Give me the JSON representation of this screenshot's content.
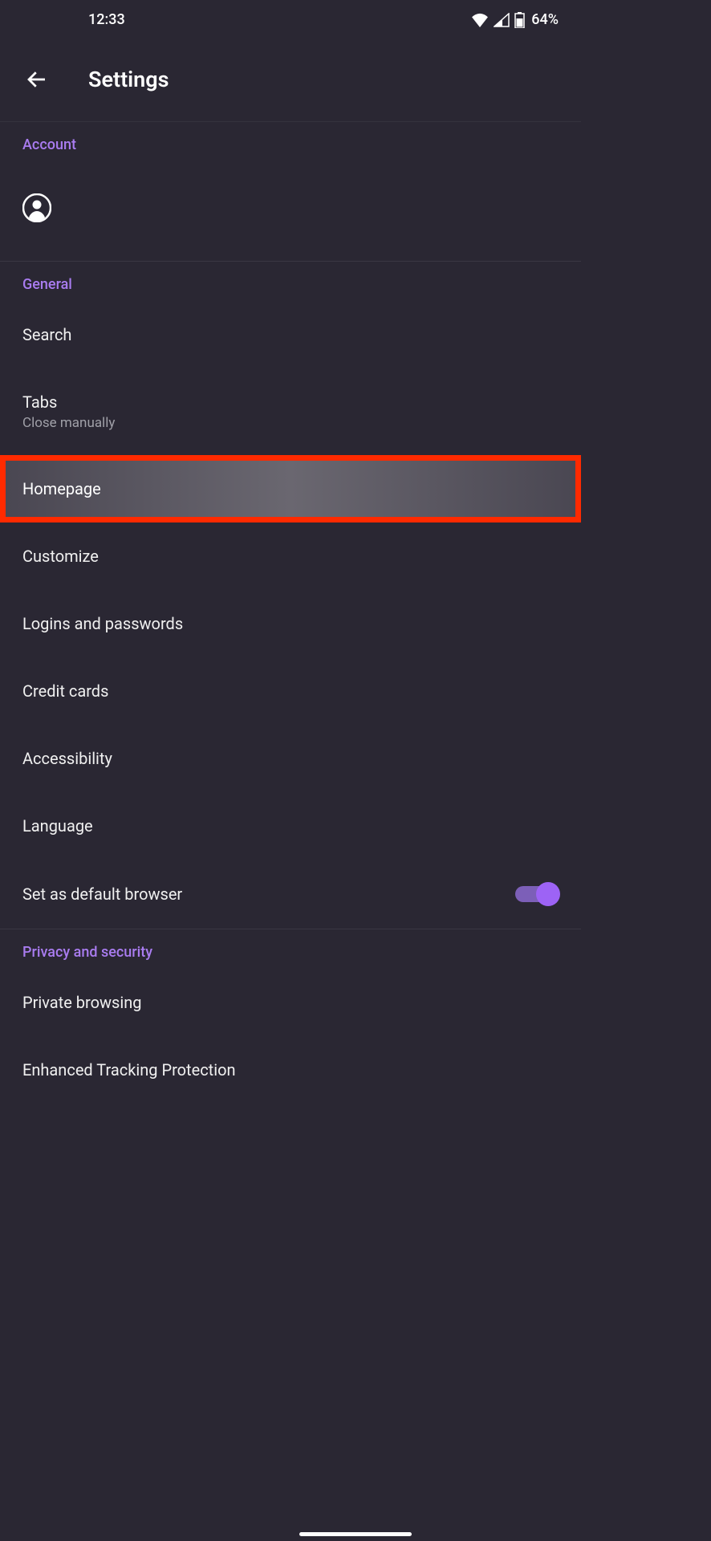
{
  "status_bar": {
    "time": "12:33",
    "battery": "64%"
  },
  "header": {
    "title": "Settings"
  },
  "sections": {
    "account": {
      "header": "Account"
    },
    "general": {
      "header": "General",
      "items": {
        "search": "Search",
        "tabs": "Tabs",
        "tabs_sub": "Close manually",
        "homepage": "Homepage",
        "customize": "Customize",
        "logins": "Logins and passwords",
        "credit": "Credit cards",
        "accessibility": "Accessibility",
        "language": "Language",
        "default_browser": "Set as default browser"
      }
    },
    "privacy": {
      "header": "Privacy and security",
      "items": {
        "private_browsing": "Private browsing",
        "tracking": "Enhanced Tracking Protection"
      }
    }
  }
}
